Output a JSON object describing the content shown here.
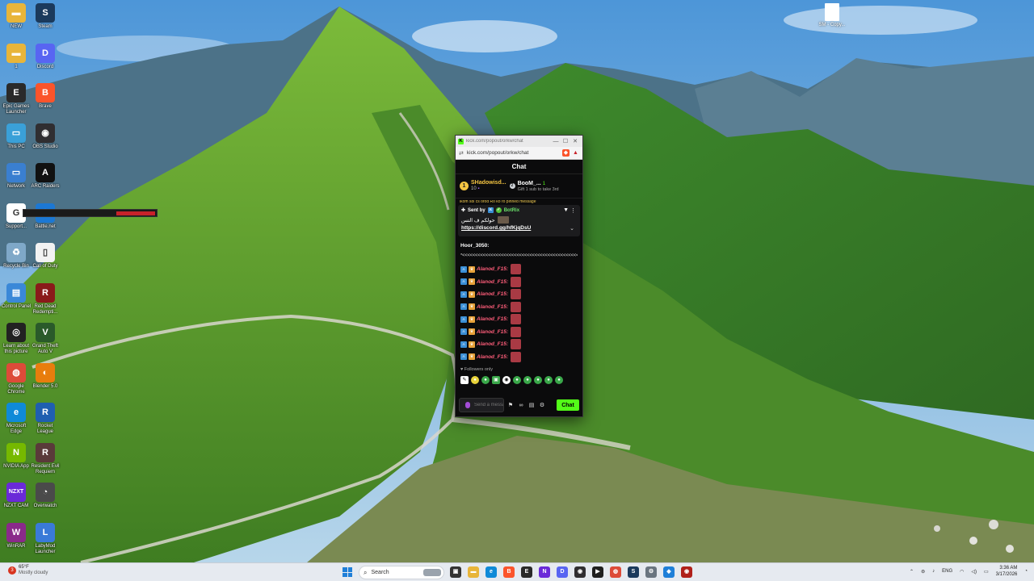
{
  "desktop": {
    "icons": [
      {
        "label": "NEW",
        "glyph": "▬",
        "color": "#e8b53a",
        "col": 0,
        "row": 0
      },
      {
        "label": "Steam",
        "glyph": "S",
        "color": "#1b3a5c",
        "col": 1,
        "row": 0
      },
      {
        "label": "1",
        "glyph": "▬",
        "color": "#e8b53a",
        "col": 0,
        "row": 1
      },
      {
        "label": "Discord",
        "glyph": "D",
        "color": "#5865f2",
        "col": 1,
        "row": 1
      },
      {
        "label": "Epic Games Launcher",
        "glyph": "E",
        "color": "#2a2a2a",
        "col": 0,
        "row": 2
      },
      {
        "label": "Brave",
        "glyph": "B",
        "color": "#fb542b",
        "col": 1,
        "row": 2
      },
      {
        "label": "This PC",
        "glyph": "▭",
        "color": "#3aa0d8",
        "col": 0,
        "row": 3
      },
      {
        "label": "OBS Studio",
        "glyph": "◉",
        "color": "#302e31",
        "col": 1,
        "row": 3
      },
      {
        "label": "Network",
        "glyph": "▭",
        "color": "#3a7fd0",
        "col": 0,
        "row": 4
      },
      {
        "label": "ARC Raiders",
        "glyph": "A",
        "color": "#111111",
        "col": 1,
        "row": 4
      },
      {
        "label": "Support...",
        "glyph": "G",
        "color": "#ffffff",
        "col": 0,
        "row": 5
      },
      {
        "label": "Battle.net",
        "glyph": "✦",
        "color": "#1c78d4",
        "col": 1,
        "row": 5
      },
      {
        "label": "Recycle Bin",
        "glyph": "♻",
        "color": "#7fa8c8",
        "col": 0,
        "row": 6
      },
      {
        "label": "Call of Duty",
        "glyph": "▯",
        "color": "#f2f2f2",
        "col": 1,
        "row": 6
      },
      {
        "label": "Control Panel",
        "glyph": "▤",
        "color": "#3a88d8",
        "col": 0,
        "row": 7
      },
      {
        "label": "Red Dead Redempti...",
        "glyph": "R",
        "color": "#8a1a1a",
        "col": 1,
        "row": 7
      },
      {
        "label": "Learn about this picture",
        "glyph": "◎",
        "color": "#222222",
        "col": 0,
        "row": 8
      },
      {
        "label": "Grand Theft Auto V",
        "glyph": "V",
        "color": "#2a5a2a",
        "col": 1,
        "row": 8
      },
      {
        "label": "Google Chrome",
        "glyph": "◍",
        "color": "#dd4b39",
        "col": 0,
        "row": 9
      },
      {
        "label": "Blender 5.0",
        "glyph": "◐",
        "color": "#e87d0d",
        "col": 1,
        "row": 9
      },
      {
        "label": "Microsoft Edge",
        "glyph": "e",
        "color": "#0f8ad8",
        "col": 0,
        "row": 10
      },
      {
        "label": "Rocket League",
        "glyph": "R",
        "color": "#1f5fb0",
        "col": 1,
        "row": 10
      },
      {
        "label": "NVIDIA App",
        "glyph": "N",
        "color": "#76b900",
        "col": 0,
        "row": 11
      },
      {
        "label": "Resident Evil Requiem",
        "glyph": "R",
        "color": "#5a3a3a",
        "col": 1,
        "row": 11
      },
      {
        "label": "NZXT CAM",
        "glyph": "NZXT",
        "color": "#6a2ad8",
        "col": 0,
        "row": 12
      },
      {
        "label": "Overwatch",
        "glyph": "◔",
        "color": "#4a4a4a",
        "col": 1,
        "row": 12
      },
      {
        "label": "WinRAR",
        "glyph": "W",
        "color": "#8a2a8a",
        "col": 0,
        "row": 13
      },
      {
        "label": "LabyMod Launcher",
        "glyph": "L",
        "color": "#3a7ad8",
        "col": 1,
        "row": 13
      }
    ],
    "top_file_label": "SM - Copy..."
  },
  "browser": {
    "title": "kick.com/popout/orkw/chat",
    "url": "kick.com/popout/orkw/chat",
    "chat_title": "Chat",
    "gifters": {
      "first": {
        "rank": "1",
        "name": "SHadowisd...",
        "count": "10"
      },
      "second": {
        "name": "BooM_...",
        "count": "1",
        "cta": "Gift 1 sub to take 3rd"
      }
    },
    "pinned_strip": "ikom sol cs orod Ro ko ro pinned message",
    "pinned": {
      "sent_by_label": "Sent by",
      "bot_name": "BotRix",
      "arabic_text": "حولكم ف التس",
      "link": "https://discord.gg/hfKjqDsU"
    },
    "message": {
      "user": "Hoor_3050:",
      "text": "*<<<<<<<<<<<<<<<<<<<<<<<<<<<<<<<<<<<<<<<<<<<<<<<<<*"
    },
    "spam": {
      "name": "Alanod_F15:",
      "rows": 8
    },
    "followers_only": "Followers only",
    "input_placeholder": "Send a message",
    "chat_button": "Chat"
  },
  "taskbar": {
    "weather_temp": "65°F",
    "weather_desc": "Mostly cloudy",
    "search_placeholder": "Search",
    "language": "ENG",
    "time": "3:36 AM",
    "date": "3/17/2026",
    "apps": [
      {
        "name": "task-view",
        "glyph": "▣",
        "color": "#333333"
      },
      {
        "name": "file-explorer",
        "glyph": "▬",
        "color": "#e8b53a"
      },
      {
        "name": "edge",
        "glyph": "e",
        "color": "#0f8ad8"
      },
      {
        "name": "brave",
        "glyph": "B",
        "color": "#fb542b"
      },
      {
        "name": "epic",
        "glyph": "E",
        "color": "#2a2a2a"
      },
      {
        "name": "nzxt",
        "glyph": "N",
        "color": "#6a2ad8"
      },
      {
        "name": "discord",
        "glyph": "D",
        "color": "#5865f2"
      },
      {
        "name": "obs",
        "glyph": "◉",
        "color": "#302e31"
      },
      {
        "name": "terminal",
        "glyph": "▶",
        "color": "#1f1f1f"
      },
      {
        "name": "chrome",
        "glyph": "◍",
        "color": "#dd4b39"
      },
      {
        "name": "steam",
        "glyph": "S",
        "color": "#1b3a5c"
      },
      {
        "name": "settings",
        "glyph": "⚙",
        "color": "#6a7580"
      },
      {
        "name": "vs-code",
        "glyph": "◆",
        "color": "#1f7fd8"
      },
      {
        "name": "obs-live",
        "glyph": "◉",
        "color": "#b0201a"
      }
    ]
  }
}
